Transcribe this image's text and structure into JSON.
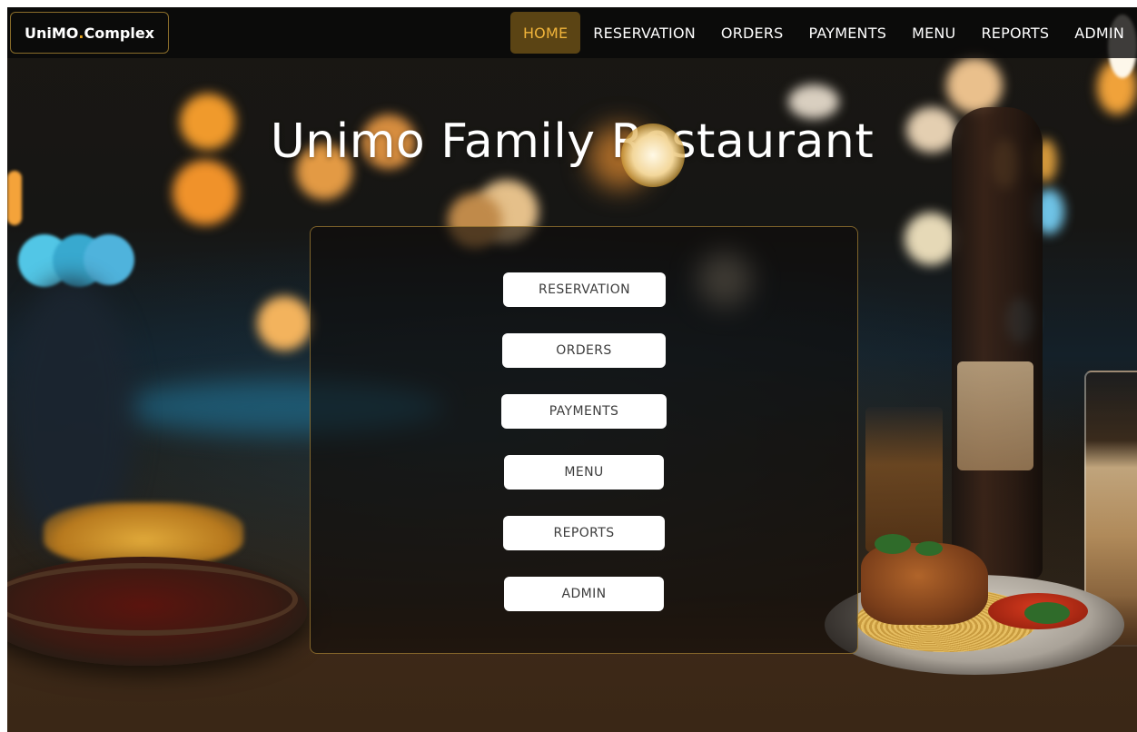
{
  "brand": {
    "text_main": "UniMO",
    "text_dot": ".",
    "text_suffix": "Complex",
    "accent_color": "#e5a21c"
  },
  "nav": {
    "items": [
      {
        "label": "HOME",
        "active": true
      },
      {
        "label": "RESERVATION",
        "active": false
      },
      {
        "label": "ORDERS",
        "active": false
      },
      {
        "label": "PAYMENTS",
        "active": false
      },
      {
        "label": "MENU",
        "active": false
      },
      {
        "label": "REPORTS",
        "active": false
      },
      {
        "label": "ADMIN",
        "active": false
      }
    ],
    "active_bg_color": "#5b4414",
    "active_text_color": "#f0b43a"
  },
  "hero": {
    "title": "Unimo Family Restaurant"
  },
  "panel": {
    "border_color": "#af8737",
    "buttons": [
      {
        "label": "RESERVATION"
      },
      {
        "label": "ORDERS"
      },
      {
        "label": "PAYMENTS"
      },
      {
        "label": "MENU"
      },
      {
        "label": "REPORTS"
      },
      {
        "label": "ADMIN"
      }
    ]
  },
  "background": {
    "description_icon": "restaurant-photo-background"
  }
}
